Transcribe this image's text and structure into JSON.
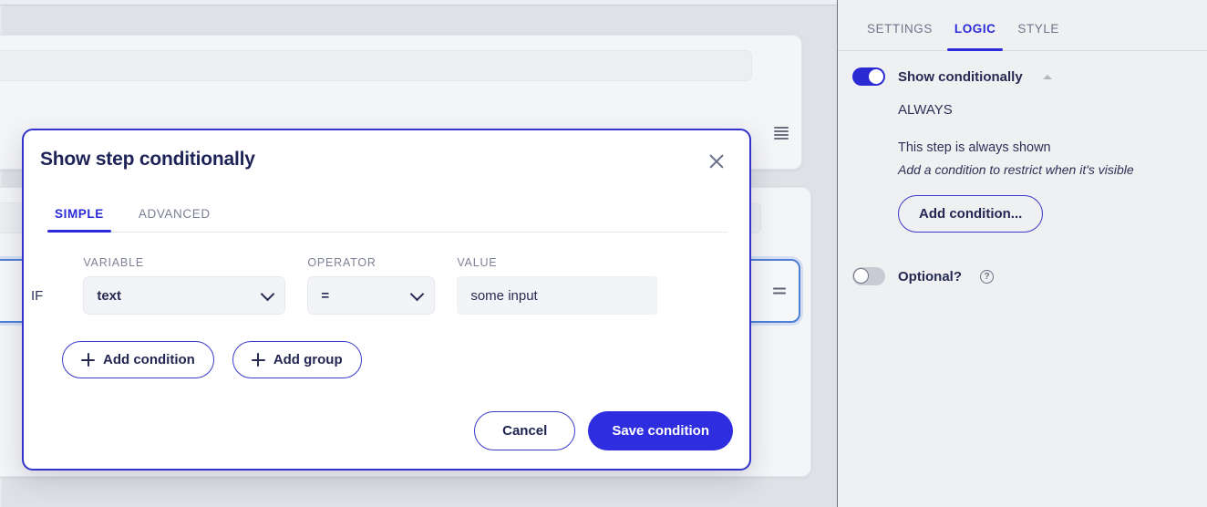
{
  "sidebar": {
    "tabs": [
      {
        "label": "SETTINGS",
        "active": false
      },
      {
        "label": "LOGIC",
        "active": true
      },
      {
        "label": "STYLE",
        "active": false
      }
    ],
    "show_conditionally": {
      "label": "Show conditionally",
      "toggle_state": "on",
      "collapse_icon": "caret-up-icon",
      "condition_mode": "ALWAYS",
      "description": "This step is always shown",
      "hint": "Add a condition to restrict when it's visible",
      "add_condition_label": "Add condition..."
    },
    "optional": {
      "label": "Optional?",
      "toggle_state": "off",
      "help_icon": "question-mark-icon",
      "help_glyph": "?"
    }
  },
  "modal": {
    "title": "Show step conditionally",
    "close_icon": "close-x-icon",
    "tabs": [
      {
        "label": "SIMPLE",
        "active": true
      },
      {
        "label": "ADVANCED",
        "active": false
      }
    ],
    "condition": {
      "if_label": "IF",
      "variable_label": "VARIABLE",
      "variable_value": "text",
      "operator_label": "OPERATOR",
      "operator_value": "=",
      "value_label": "VALUE",
      "value_text": "some input",
      "value_placeholder": "some input"
    },
    "add_condition_label": "Add condition",
    "add_group_label": "Add group",
    "cancel_label": "Cancel",
    "save_label": "Save condition"
  },
  "colors": {
    "accent_blue": "#2b2bd9",
    "save_button": "#2e2ee0",
    "toggle_on": "#2b2bd4",
    "toggle_off": "#c8cbd3",
    "navy_text": "#262b52",
    "muted_text": "#7a7f93",
    "canvas_bg": "#dfe1e6",
    "sidebar_bg": "#eff0f2",
    "modal_border": "#3333cc",
    "card_selected_border": "#4d7fd6"
  }
}
